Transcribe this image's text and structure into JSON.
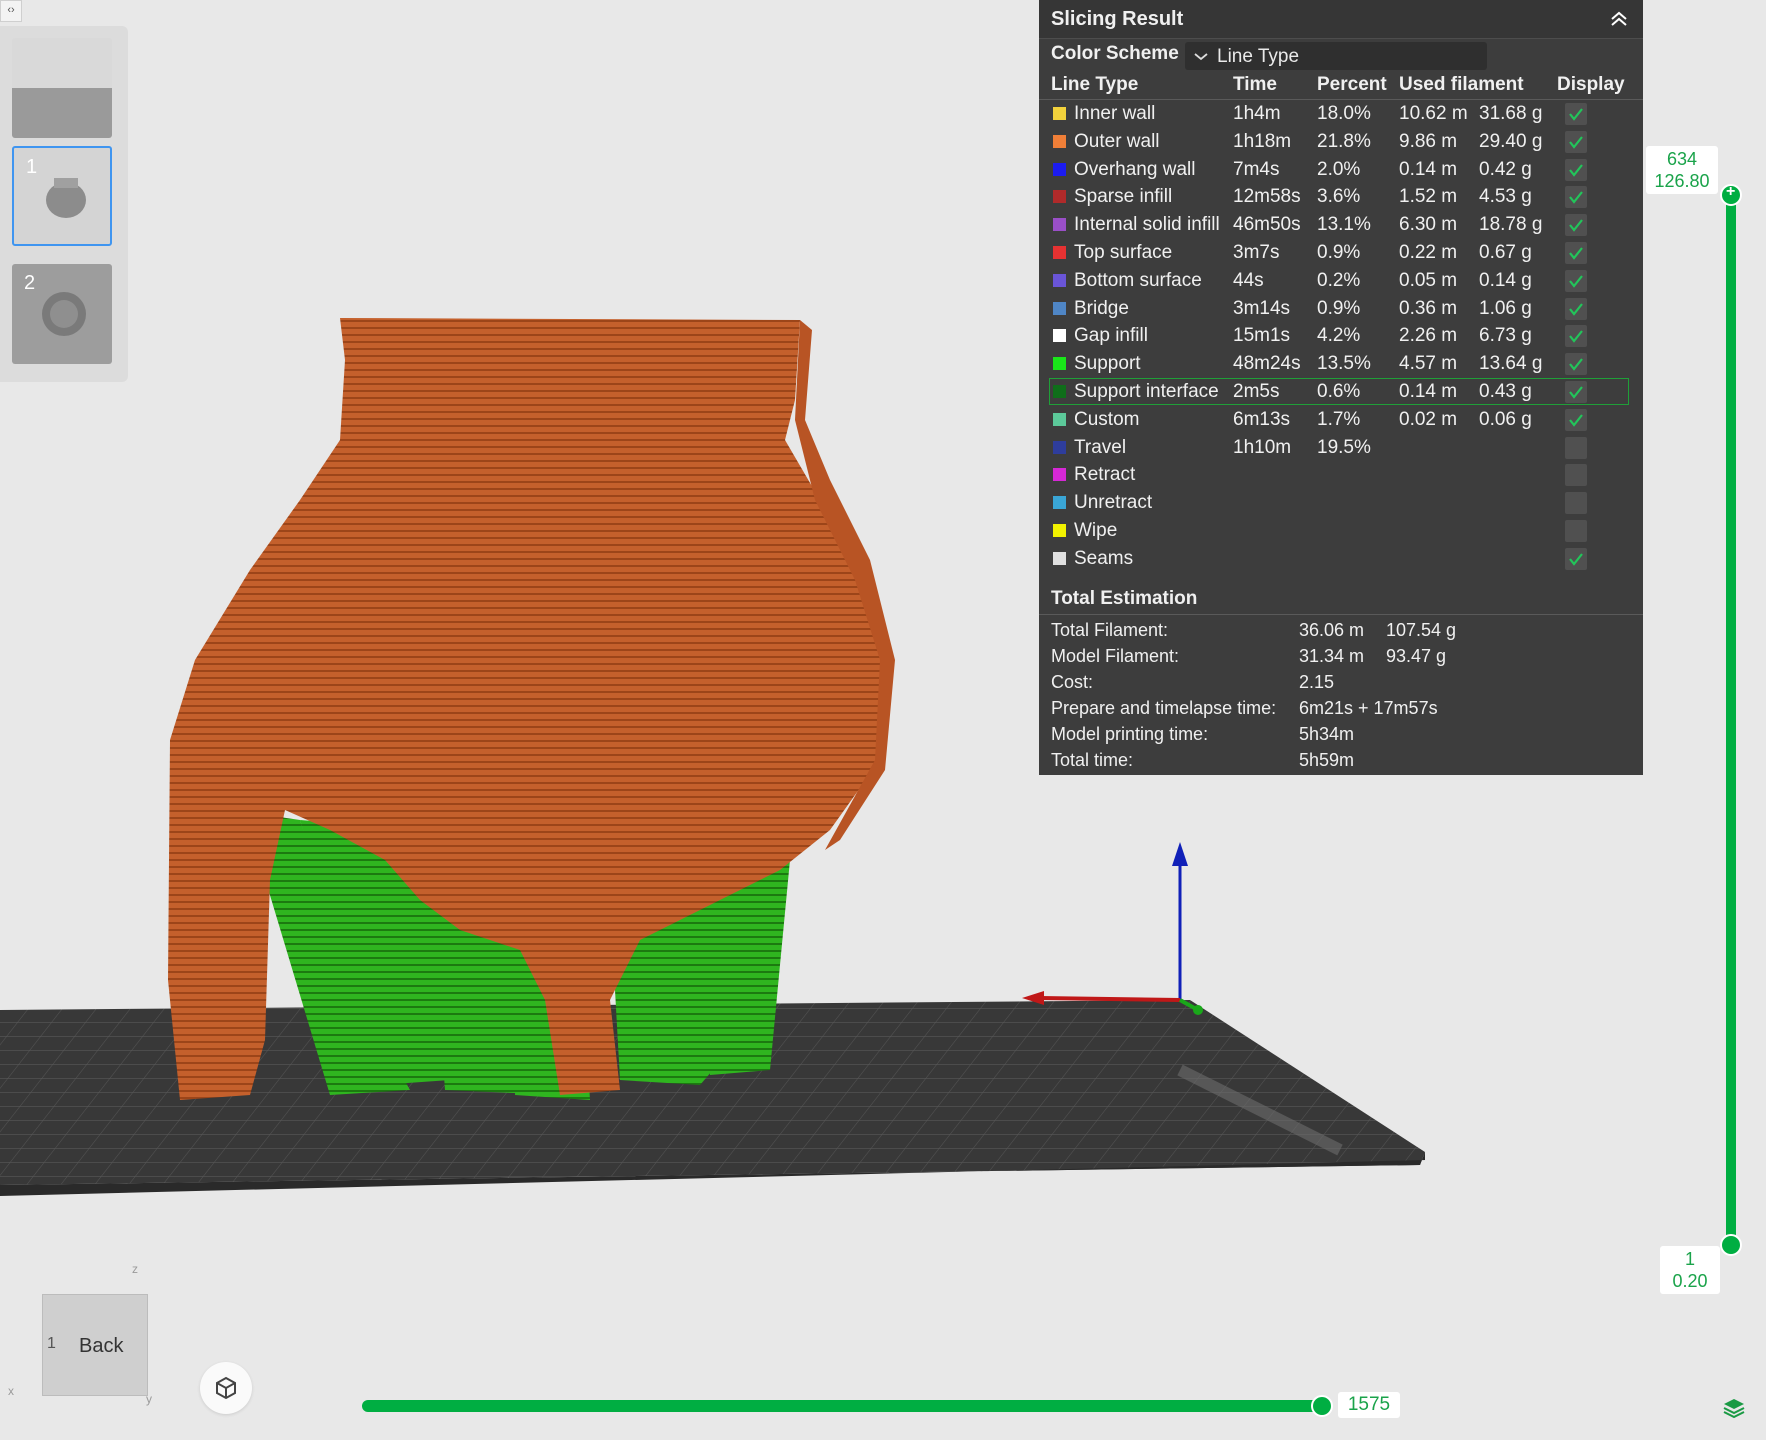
{
  "panel": {
    "title": "Slicing Result",
    "color_scheme_label": "Color Scheme",
    "color_scheme_value": "Line Type",
    "columns": [
      "Line Type",
      "Time",
      "Percent",
      "Used filament",
      "Display"
    ],
    "rows": [
      {
        "name": "Inner wall",
        "color": "#f2d23c",
        "time": "1h4m",
        "percent": "18.0%",
        "length": "10.62 m",
        "weight": "31.68 g",
        "display": true
      },
      {
        "name": "Outer wall",
        "color": "#f07f38",
        "time": "1h18m",
        "percent": "21.8%",
        "length": "9.86 m",
        "weight": "29.40 g",
        "display": true
      },
      {
        "name": "Overhang wall",
        "color": "#1c1cf0",
        "time": "7m4s",
        "percent": "2.0%",
        "length": "0.14 m",
        "weight": "0.42 g",
        "display": true
      },
      {
        "name": "Sparse infill",
        "color": "#b02a2a",
        "time": "12m58s",
        "percent": "3.6%",
        "length": "1.52 m",
        "weight": "4.53 g",
        "display": true
      },
      {
        "name": "Internal solid infill",
        "color": "#9a4fc8",
        "time": "46m50s",
        "percent": "13.1%",
        "length": "6.30 m",
        "weight": "18.78 g",
        "display": true
      },
      {
        "name": "Top surface",
        "color": "#e63232",
        "time": "3m7s",
        "percent": "0.9%",
        "length": "0.22 m",
        "weight": "0.67 g",
        "display": true
      },
      {
        "name": "Bottom surface",
        "color": "#6a55d8",
        "time": "44s",
        "percent": "0.2%",
        "length": "0.05 m",
        "weight": "0.14 g",
        "display": true
      },
      {
        "name": "Bridge",
        "color": "#4f86c6",
        "time": "3m14s",
        "percent": "0.9%",
        "length": "0.36 m",
        "weight": "1.06 g",
        "display": true
      },
      {
        "name": "Gap infill",
        "color": "#ffffff",
        "time": "15m1s",
        "percent": "4.2%",
        "length": "2.26 m",
        "weight": "6.73 g",
        "display": true
      },
      {
        "name": "Support",
        "color": "#19e619",
        "time": "48m24s",
        "percent": "13.5%",
        "length": "4.57 m",
        "weight": "13.64 g",
        "display": true
      },
      {
        "name": "Support interface",
        "color": "#0f6e1a",
        "time": "2m5s",
        "percent": "0.6%",
        "length": "0.14 m",
        "weight": "0.43 g",
        "display": true
      },
      {
        "name": "Custom",
        "color": "#5cc99a",
        "time": "6m13s",
        "percent": "1.7%",
        "length": "0.02 m",
        "weight": "0.06 g",
        "display": true
      },
      {
        "name": "Travel",
        "color": "#2e3d9c",
        "time": "1h10m",
        "percent": "19.5%",
        "length": "",
        "weight": "",
        "display": false
      },
      {
        "name": "Retract",
        "color": "#d628d6",
        "time": "",
        "percent": "",
        "length": "",
        "weight": "",
        "display": false
      },
      {
        "name": "Unretract",
        "color": "#3aa6d6",
        "time": "",
        "percent": "",
        "length": "",
        "weight": "",
        "display": false
      },
      {
        "name": "Wipe",
        "color": "#f2f200",
        "time": "",
        "percent": "",
        "length": "",
        "weight": "",
        "display": false
      },
      {
        "name": "Seams",
        "color": "#e0e0e0",
        "time": "",
        "percent": "",
        "length": "",
        "weight": "",
        "display": true
      }
    ],
    "selected_row": "Support interface",
    "estimation": {
      "title": "Total Estimation",
      "rows": [
        {
          "key": "Total Filament:",
          "v1": "36.06 m",
          "v2": "107.54 g"
        },
        {
          "key": "Model Filament:",
          "v1": "31.34 m",
          "v2": "93.47 g"
        },
        {
          "key": "Cost:",
          "v1": "2.15",
          "v2": ""
        },
        {
          "key": "Prepare and timelapse time:",
          "v1": "6m21s + 17m57s",
          "v2": ""
        },
        {
          "key": "Model printing time:",
          "v1": "5h34m",
          "v2": ""
        },
        {
          "key": "Total time:",
          "v1": "5h59m",
          "v2": ""
        }
      ]
    }
  },
  "layer_slider": {
    "top_layer": "634",
    "top_height": "126.80",
    "bottom_layer": "1",
    "bottom_height": "0.20",
    "top_fraction": 1.0,
    "bottom_fraction": 0.0
  },
  "move_slider": {
    "value": "1575",
    "fraction": 1.0
  },
  "plates": [
    {
      "number": ""
    },
    {
      "number": "1"
    },
    {
      "number": "2"
    }
  ],
  "view_cube": {
    "face_label": "Back",
    "axis_z": "z",
    "axis_x": "x",
    "axis_y": "y"
  },
  "colors": {
    "accent": "#00ae42",
    "model": "#c8602a",
    "support": "#2fb51f",
    "plate": "#3a3a3a",
    "panel_bg": "#3d3d3d"
  },
  "icons": [
    "panel-toggle-icon",
    "collapse-up-icon",
    "chevron-down-icon",
    "checkmark-icon",
    "fit-view-icon",
    "layers-icon"
  ]
}
